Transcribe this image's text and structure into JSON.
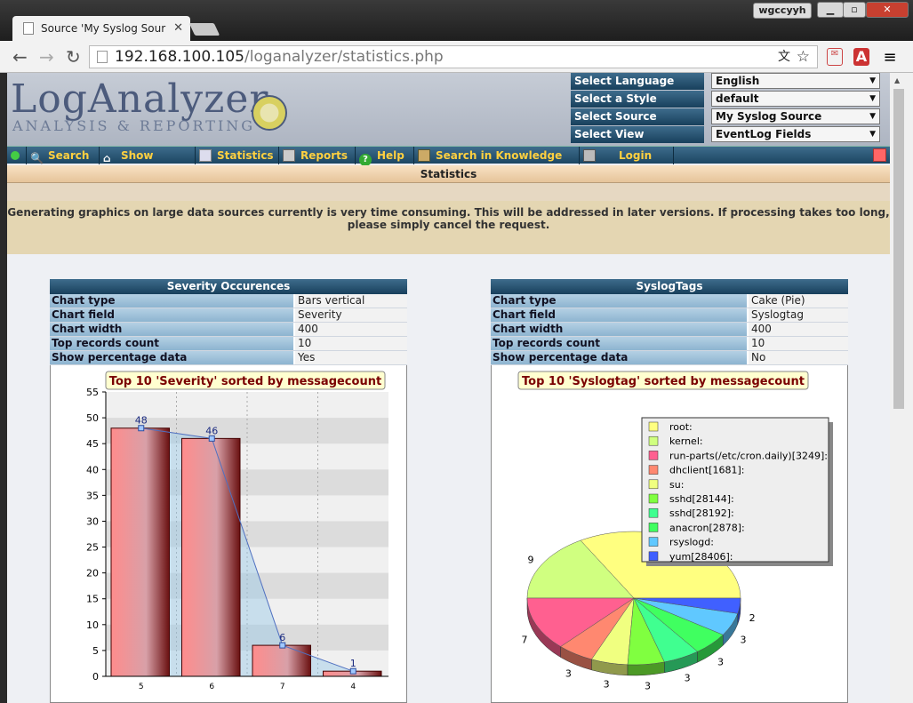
{
  "browser": {
    "tab_title": "Source 'My Syslog Sour",
    "user": "wgccyyh",
    "url_host": "192.168.100.105",
    "url_path": "/loganalyzer/statistics.php"
  },
  "header": {
    "logo": "LogAnalyzer",
    "sublogo": "ANALYSIS & REPORTING",
    "selects": [
      {
        "label": "Select Language",
        "value": "English"
      },
      {
        "label": "Select a Style",
        "value": "default"
      },
      {
        "label": "Select Source",
        "value": "My Syslog Source"
      },
      {
        "label": "Select View",
        "value": "EventLog Fields"
      }
    ]
  },
  "menu": [
    "Search",
    "Show Events",
    "Statistics",
    "Reports",
    "Help",
    "Search in Knowledge Base",
    "Login"
  ],
  "page_title": "Statistics",
  "notice": "Generating graphics on large data sources currently is very time consuming. This will be addressed in later versions. If processing takes too long, please simply cancel the request.",
  "panels": [
    {
      "title": "Severity Occurences",
      "rows": [
        [
          "Chart type",
          "Bars vertical"
        ],
        [
          "Chart field",
          "Severity"
        ],
        [
          "Chart width",
          "400"
        ],
        [
          "Top records count",
          "10"
        ],
        [
          "Show percentage data",
          "Yes"
        ]
      ]
    },
    {
      "title": "SyslogTags",
      "rows": [
        [
          "Chart type",
          "Cake (Pie)"
        ],
        [
          "Chart field",
          "Syslogtag"
        ],
        [
          "Chart width",
          "400"
        ],
        [
          "Top records count",
          "10"
        ],
        [
          "Show percentage data",
          "No"
        ]
      ]
    }
  ],
  "chart_data": [
    {
      "type": "bar",
      "title": "Top 10 'Severity' sorted by messagecount",
      "categories": [
        "5",
        "6",
        "7",
        "4"
      ],
      "values": [
        48,
        46,
        6,
        1
      ],
      "ylim": [
        0,
        55
      ],
      "yticks": [
        0,
        5,
        10,
        15,
        20,
        25,
        30,
        35,
        40,
        45,
        50,
        55
      ]
    },
    {
      "type": "pie",
      "title": "Top 10 'Syslogtag' sorted by messagecount",
      "labels": [
        "root:",
        "kernel:",
        "run-parts(/etc/cron.daily)[3249]:",
        "dhclient[1681]:",
        "su:",
        "sshd[28144]:",
        "sshd[28192]:",
        "anacron[2878]:",
        "rsyslogd:",
        "yum[28406]:"
      ],
      "values": [
        null,
        9,
        7,
        3,
        3,
        3,
        3,
        3,
        3,
        2
      ],
      "colors": [
        "#ffff80",
        "#d0ff80",
        "#ff6090",
        "#ff8870",
        "#f0ff80",
        "#80ff40",
        "#40ff90",
        "#40ff60",
        "#60c8ff",
        "#4060ff"
      ]
    }
  ]
}
